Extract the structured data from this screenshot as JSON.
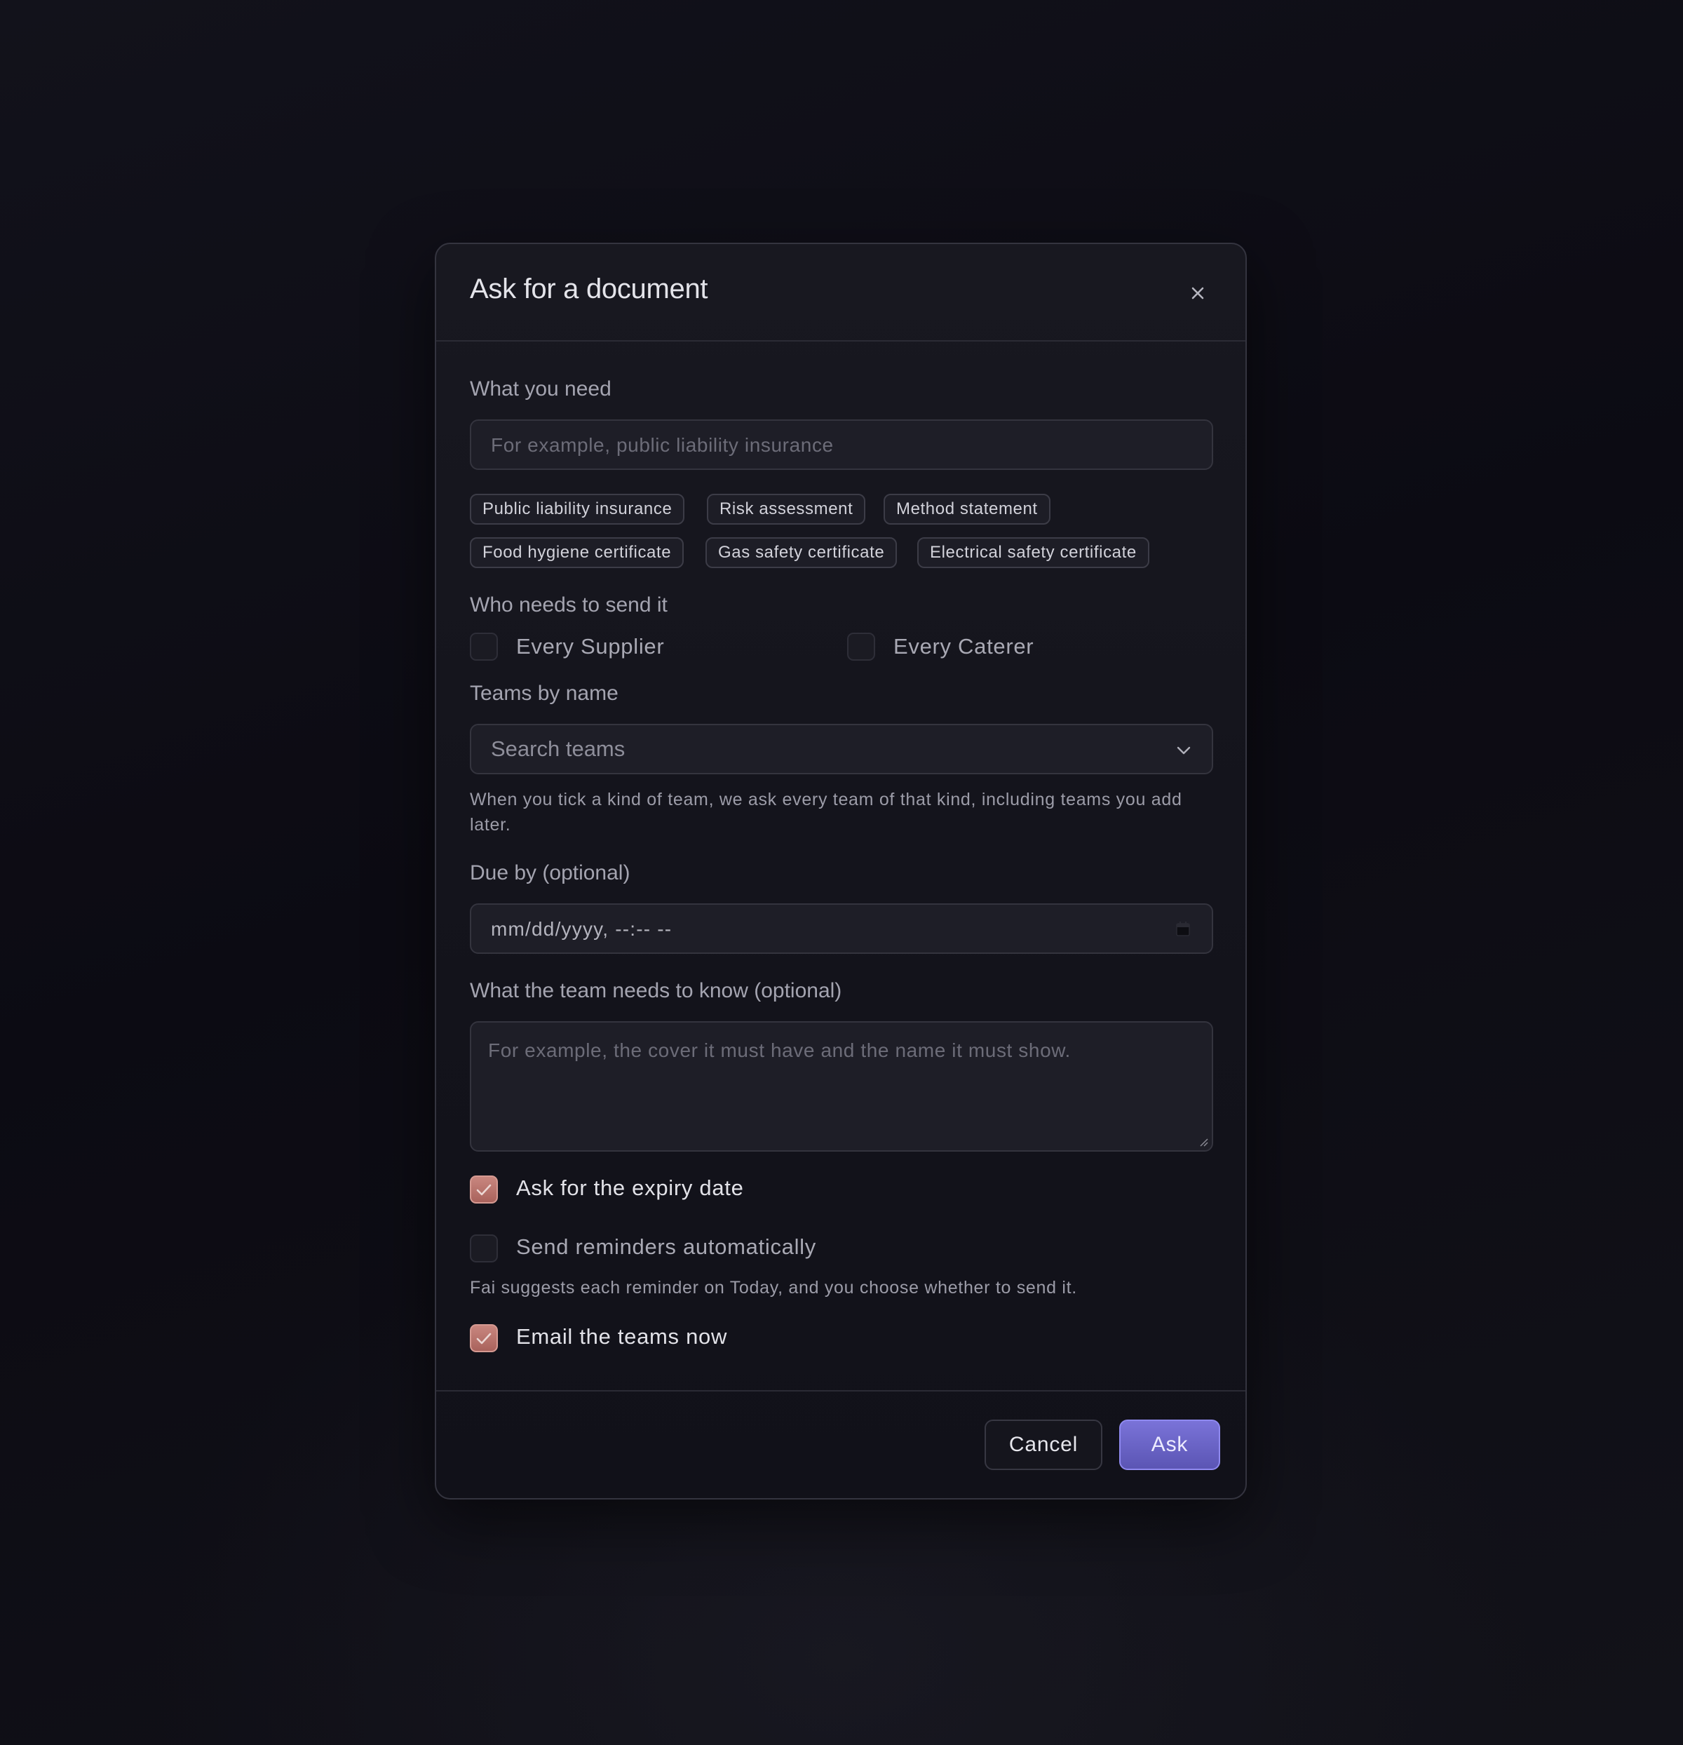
{
  "dialog": {
    "title": "Ask for a document",
    "close_icon": "close-icon"
  },
  "what_you_need": {
    "label": "What you need",
    "placeholder": "For example, public liability insurance",
    "suggestions": [
      "Public liability insurance",
      "Risk assessment",
      "Method statement",
      "Food hygiene certificate",
      "Gas safety certificate",
      "Electrical safety certificate"
    ]
  },
  "who_sends": {
    "label": "Who needs to send it",
    "options": [
      {
        "label": "Every Supplier",
        "checked": false
      },
      {
        "label": "Every Caterer",
        "checked": false
      }
    ]
  },
  "teams_by_name": {
    "label": "Teams by name",
    "placeholder": "Search teams",
    "hint": "When you tick a kind of team, we ask every team of that kind, including teams you add later."
  },
  "due_by": {
    "label": "Due by (optional)",
    "value": "mm/dd/yyyy, --:-- --"
  },
  "team_notes": {
    "label": "What the team needs to know (optional)",
    "placeholder": "For example, the cover it must have and the name it must show."
  },
  "options": {
    "expiry": {
      "label": "Ask for the expiry date",
      "checked": true
    },
    "reminders": {
      "label": "Send reminders automatically",
      "checked": false
    },
    "reminders_hint": "Fai suggests each reminder on Today, and you choose whether to send it.",
    "email_now": {
      "label": "Email the teams now",
      "checked": true
    }
  },
  "footer": {
    "cancel_label": "Cancel",
    "ask_label": "Ask"
  },
  "colors": {
    "accent": "#6b64c8",
    "checked": "#b8716a"
  }
}
